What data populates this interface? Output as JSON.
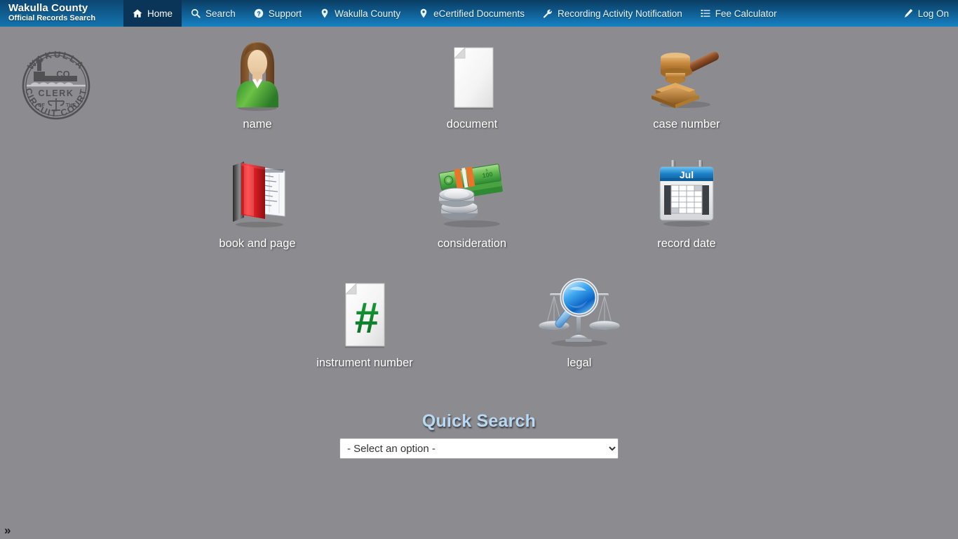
{
  "brand": {
    "title": "Wakulla County",
    "subtitle": "Official Records Search"
  },
  "nav": {
    "items": [
      {
        "label": "Home",
        "icon": "home-icon",
        "active": true
      },
      {
        "label": "Search",
        "icon": "search-icon",
        "active": false
      },
      {
        "label": "Support",
        "icon": "question-circle-icon",
        "active": false
      },
      {
        "label": "Wakulla County",
        "icon": "map-marker-icon",
        "active": false
      },
      {
        "label": "eCertified Documents",
        "icon": "map-marker-icon",
        "active": false
      },
      {
        "label": "Recording Activity Notification",
        "icon": "wrench-icon",
        "active": false
      },
      {
        "label": "Fee Calculator",
        "icon": "list-icon",
        "active": false
      }
    ],
    "right": {
      "label": "Log On",
      "icon": "pencil-icon"
    }
  },
  "seal": {
    "name": "wakulla-county-clerk-seal",
    "text_top": "WAKULLA",
    "text_co": "CO",
    "text_mid": "CLERK",
    "text_of": "OF",
    "text_the": "THE",
    "text_bottom": "CIRCUIT COURT"
  },
  "tiles": [
    {
      "label": "name",
      "icon": "person-icon"
    },
    {
      "label": "document",
      "icon": "document-page-icon"
    },
    {
      "label": "case number",
      "icon": "gavel-icon"
    },
    {
      "label": "book and page",
      "icon": "open-book-icon"
    },
    {
      "label": "consideration",
      "icon": "money-coins-icon"
    },
    {
      "label": "record date",
      "icon": "calendar-icon"
    },
    {
      "label": "instrument number",
      "icon": "hash-page-icon"
    },
    {
      "label": "legal",
      "icon": "scales-magnifier-icon"
    }
  ],
  "calendar": {
    "month_label": "Jul"
  },
  "quick_search": {
    "title": "Quick Search",
    "selected_option": "- Select an option -",
    "options": [
      "- Select an option -"
    ]
  },
  "footer": {
    "expander_glyph": "»"
  },
  "colors": {
    "page_background": "#8c8c90",
    "header_top": "#0a3d63",
    "header_bottom": "#1782c4",
    "active_tab": "#0b3558",
    "quick_search_title": "#b8d9ef",
    "caption_text": "#ffffff"
  }
}
